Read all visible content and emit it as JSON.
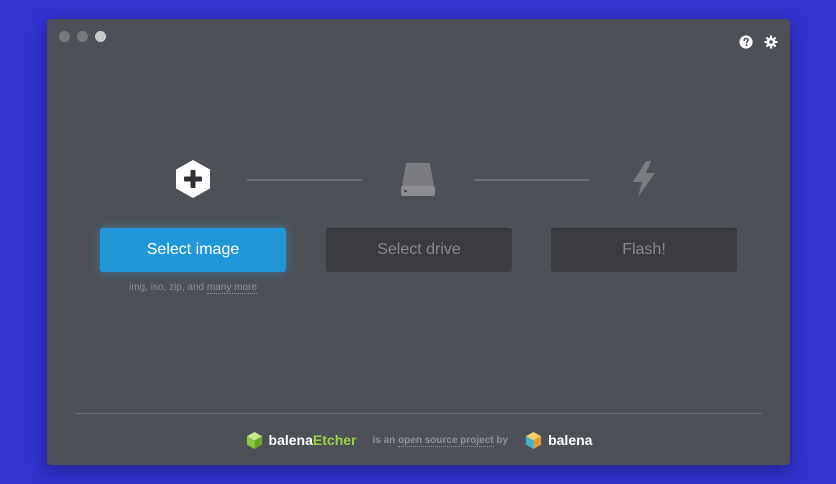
{
  "colors": {
    "background": "#3333d1",
    "window": "#4d5057",
    "primary": "#2197d9",
    "disabled_button": "#3a3c41",
    "etcher_green": "#9ad14a"
  },
  "window_controls": [
    "close",
    "minimize",
    "zoom"
  ],
  "toolbar": {
    "help_icon": "question-circle-icon",
    "settings_icon": "gear-icon"
  },
  "steps": [
    {
      "icon": "plus-hexagon-icon",
      "button_label": "Select image",
      "state": "active"
    },
    {
      "icon": "drive-icon",
      "button_label": "Select drive",
      "state": "disabled"
    },
    {
      "icon": "lightning-icon",
      "button_label": "Flash!",
      "state": "disabled"
    }
  ],
  "image_hint": {
    "prefix": "img, iso, zip, and ",
    "link": "many more"
  },
  "footer": {
    "product_part1": "balena",
    "product_part2": "Etcher",
    "tagline_prefix": "is an ",
    "tagline_link": "open source project",
    "tagline_suffix": " by",
    "company": "balena"
  }
}
